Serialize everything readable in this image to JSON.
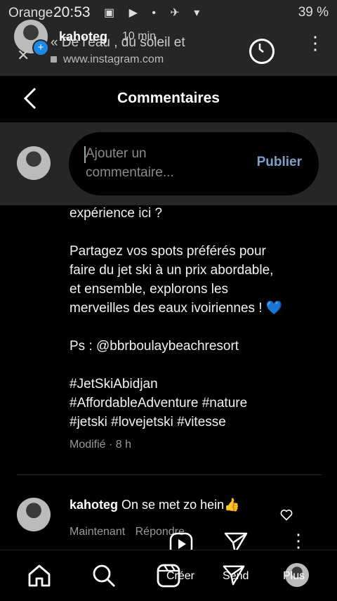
{
  "status_bar": {
    "carrier": "Orange",
    "time": "20:53",
    "battery": "39 %"
  },
  "url_bar": {
    "story_user": "kahoteg",
    "story_time": "10 min",
    "page_title": "« De l'eau , du soleil et",
    "url": "www.instagram.com"
  },
  "header": {
    "title": "Commentaires"
  },
  "composer": {
    "placeholder_line1": "Ajouter un",
    "placeholder_line2": "commentaire...",
    "publish_label": "Publier"
  },
  "caption": {
    "line1": "expérience ici ?",
    "para2": [
      "Partagez vos spots préférés pour",
      "faire du jet ski à un prix abordable,",
      "et ensemble, explorons les",
      "merveilles des eaux ivoiriennes !"
    ],
    "ps": "Ps : @bbrboulaybeachresort",
    "hashtags": [
      "#JetSkiAbidjan",
      "#AffordableAdventure #nature",
      "#jetski #lovejetski #vitesse"
    ],
    "emoji": "💙",
    "modified": "Modifié · 8 h"
  },
  "comment": {
    "username": "kahoteg",
    "text": "On se met zo hein👍",
    "time": "Maintenant",
    "reply": "Répondre"
  },
  "nav": {
    "create_label": "Créer",
    "send_label": "Send",
    "more_label": "Plus"
  }
}
